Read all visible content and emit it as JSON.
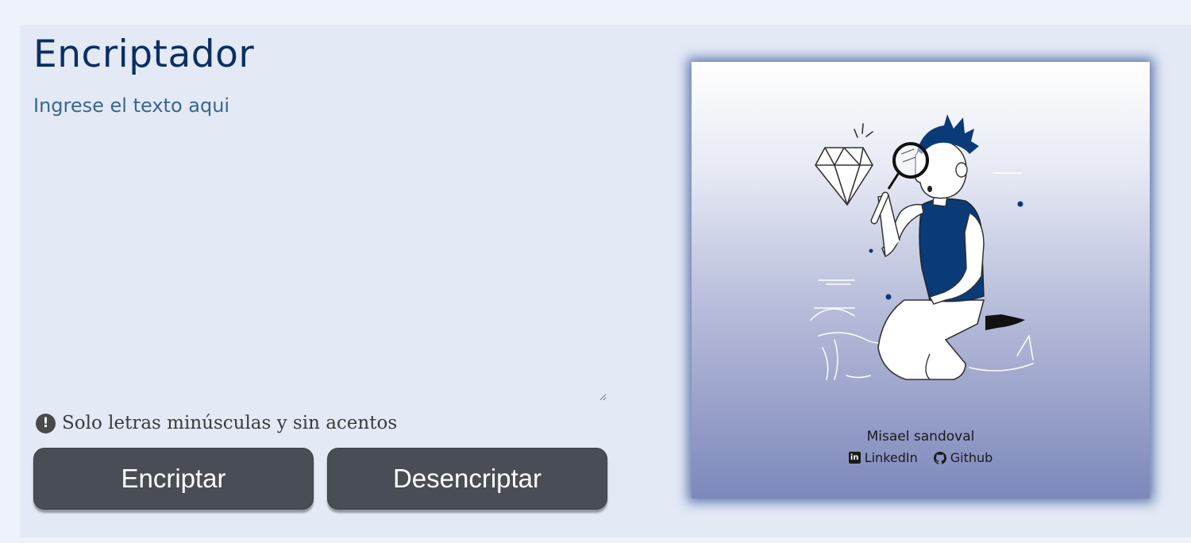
{
  "header": {
    "title": "Encriptador"
  },
  "input": {
    "placeholder": "Ingrese el texto aqui",
    "value": ""
  },
  "hint": {
    "icon": "exclamation-circle-icon",
    "text": "Solo letras minúsculas y sin acentos"
  },
  "buttons": {
    "encrypt_label": "Encriptar",
    "decrypt_label": "Desencriptar"
  },
  "output_panel": {
    "illustration": "person-with-magnifying-glass-looking-at-diamond",
    "author": "Misael sandoval",
    "links": [
      {
        "label": "LinkedIn",
        "icon": "linkedin-icon"
      },
      {
        "label": "Github",
        "icon": "github-icon"
      }
    ]
  },
  "colors": {
    "title": "#0b2f62",
    "accent": "#0a3a78",
    "button_bg": "#494d55",
    "button_text": "#ffffff",
    "panel_bg": "#e4e9f6",
    "card_gradient_bottom": "#7d88bb"
  }
}
